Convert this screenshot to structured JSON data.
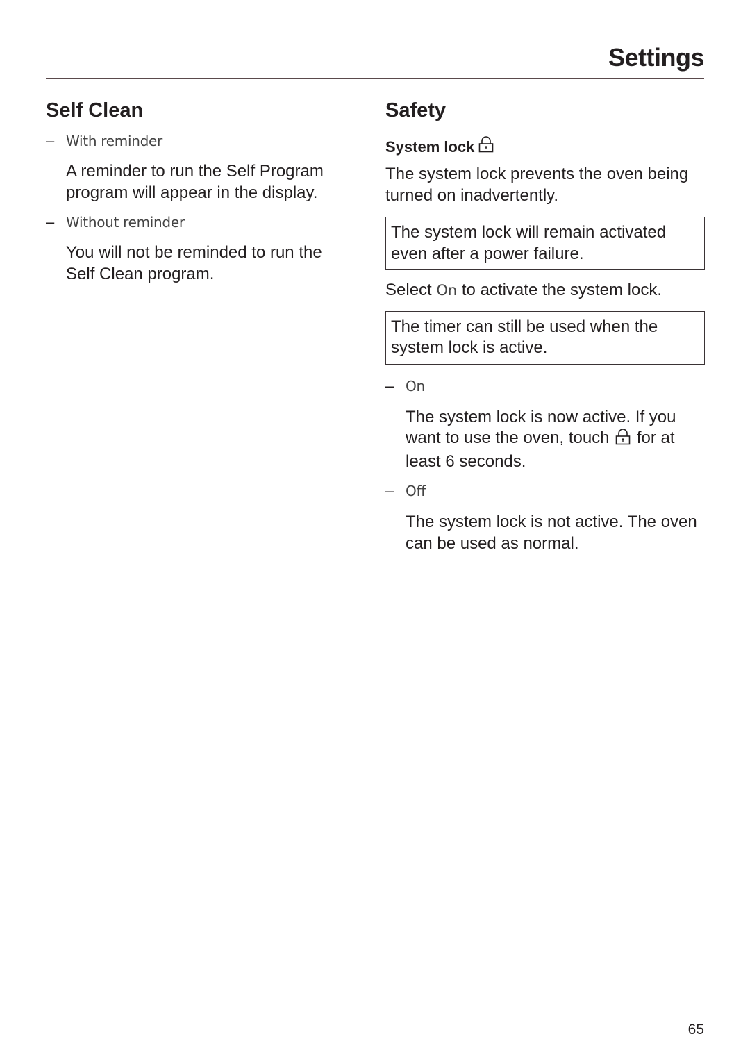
{
  "header": {
    "title": "Settings"
  },
  "self_clean": {
    "heading": "Self Clean",
    "options": [
      {
        "label": "With reminder",
        "description": "A reminder to run the Self Program program will appear in the display."
      },
      {
        "label": "Without reminder",
        "description": "You will not be reminded to run the Self Clean program."
      }
    ]
  },
  "safety": {
    "heading": "Safety",
    "system_lock": {
      "subheading": "System lock",
      "icon": "lock-icon",
      "intro": "The system lock prevents the oven being turned on inadvertently.",
      "note_1": "The system lock will remain activated even after a power failure.",
      "select_prefix": "Select",
      "select_option": "On",
      "select_suffix": "to activate the system lock.",
      "note_2": "The timer can still be used when the system lock is active.",
      "options": [
        {
          "label": "On",
          "description_part1": "The system lock is now active. If you want to use the oven, touch",
          "description_part2": "for at least 6 seconds."
        },
        {
          "label": "Off",
          "description": "The system lock is not active. The oven can be used as normal."
        }
      ]
    }
  },
  "footer": {
    "page_number": "65"
  }
}
